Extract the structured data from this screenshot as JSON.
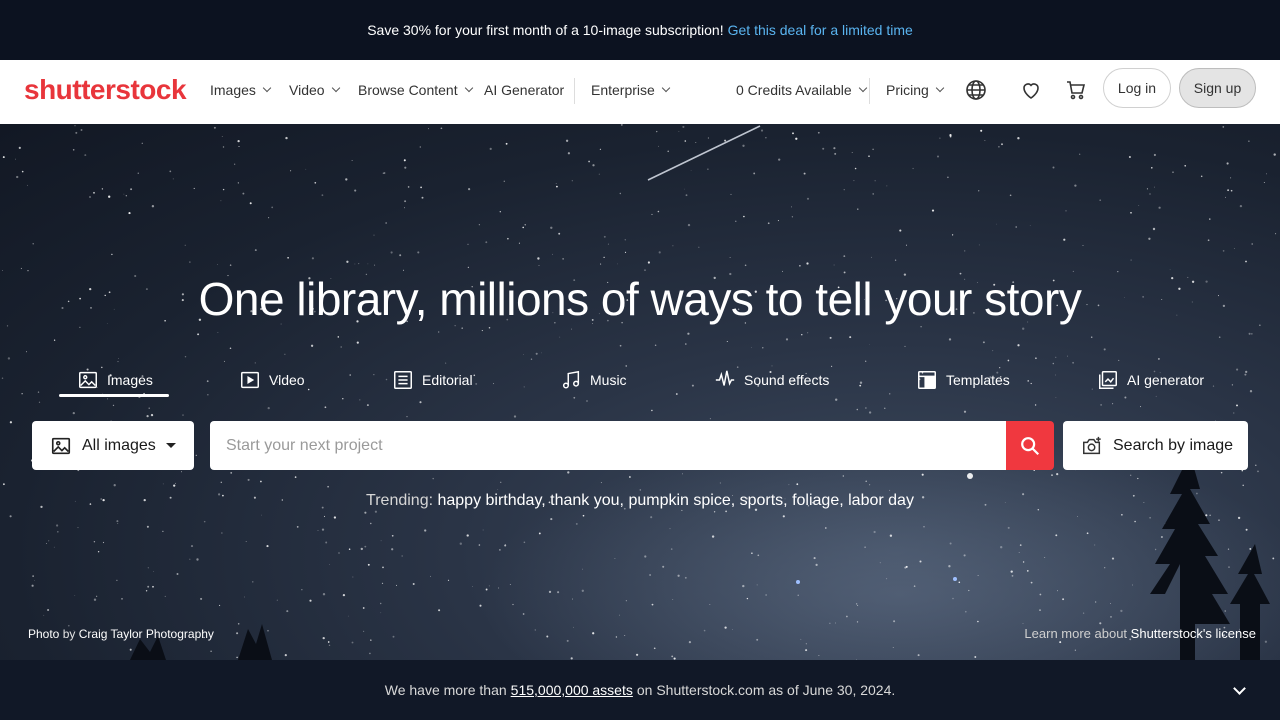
{
  "promo": {
    "text": "Save 30% for your first month of a 10-image subscription!",
    "link": "Get this deal for a limited time"
  },
  "header": {
    "logo": "shutterstock",
    "nav": {
      "images": "Images",
      "video": "Video",
      "browse": "Browse Content",
      "ai": "AI Generator",
      "enterprise": "Enterprise",
      "credits": "0 Credits Available",
      "pricing": "Pricing"
    },
    "login": "Log in",
    "signup": "Sign up"
  },
  "hero": {
    "headline": "One library, millions of ways to tell your story",
    "tabs": {
      "images": "Images",
      "video": "Video",
      "editorial": "Editorial",
      "music": "Music",
      "sound": "Sound effects",
      "templates": "Templates",
      "ai": "AI generator"
    },
    "search": {
      "type_select": "All images",
      "placeholder": "Start your next project",
      "by_image": "Search by image"
    },
    "trending": {
      "label": "Trending:",
      "items": [
        "happy birthday,",
        "thank you,",
        "pumpkin spice,",
        "sports,",
        "foliage,",
        "labor day"
      ]
    },
    "credit": {
      "photo": "Photo",
      "by": "by",
      "author": "Craig Taylor Photography"
    },
    "license": {
      "prefix": "Learn more about",
      "link": "Shutterstock's license"
    }
  },
  "footer": {
    "prefix": "We have more than",
    "count": "515,000,000 assets",
    "suffix": "on Shutterstock.com as of June 30, 2024."
  },
  "colors": {
    "brand": "#e8353b",
    "search_button": "#f0383f",
    "promo_link": "#5ab4f0"
  }
}
